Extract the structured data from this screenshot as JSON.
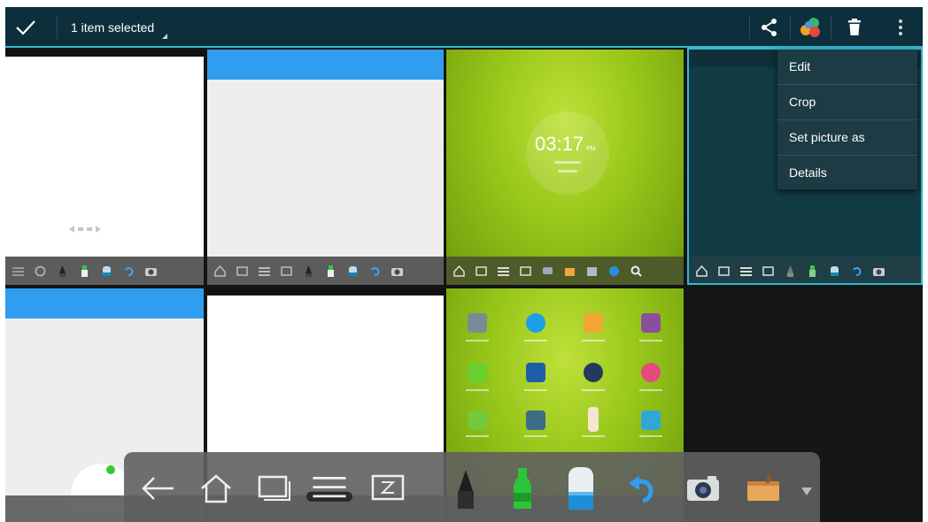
{
  "action_bar": {
    "title": "1 item selected",
    "icons": [
      "check-icon",
      "share-icon",
      "gallery-icon",
      "trash-icon",
      "more-vertical-icon"
    ]
  },
  "overflow_menu": {
    "items": [
      {
        "label": "Edit"
      },
      {
        "label": "Crop"
      },
      {
        "label": "Set picture as"
      },
      {
        "label": "Details"
      }
    ]
  },
  "thumbnails": {
    "clock_time": "03:17",
    "clock_suffix": "PM"
  },
  "floating_toolbar": {
    "icons": [
      "back-arrow-icon",
      "home-icon",
      "recent-apps-icon",
      "menu-icon",
      "screen-icon",
      "pen-icon",
      "highlighter-icon",
      "eraser-icon",
      "undo-icon",
      "camera-icon",
      "toolbox-icon",
      "dropdown-icon"
    ]
  },
  "colors": {
    "action_bar": "#0d2f3b",
    "accent": "#35b8cf",
    "menu": "#1c3b44",
    "blue_header": "#2f9ef0",
    "green_wallpaper": "#97c61a"
  }
}
